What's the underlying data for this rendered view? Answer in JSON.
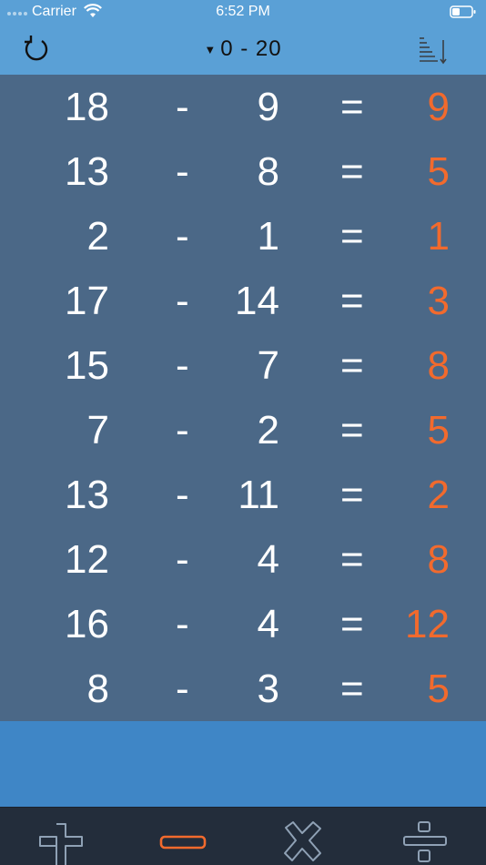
{
  "status": {
    "carrier": "Carrier",
    "time": "6:52 PM"
  },
  "nav": {
    "range_label": "0 - 20",
    "caret": "▼"
  },
  "colors": {
    "accent": "#f26a2d",
    "nav_bg": "#5aa0d6",
    "list_bg": "#4b6887",
    "band_bg": "#3f86c6",
    "tabbar_bg": "#232d3b"
  },
  "equations": [
    {
      "a": "18",
      "op": "-",
      "b": "9",
      "eq": "=",
      "result": "9"
    },
    {
      "a": "13",
      "op": "-",
      "b": "8",
      "eq": "=",
      "result": "5"
    },
    {
      "a": "2",
      "op": "-",
      "b": "1",
      "eq": "=",
      "result": "1"
    },
    {
      "a": "17",
      "op": "-",
      "b": "14",
      "eq": "=",
      "result": "3"
    },
    {
      "a": "15",
      "op": "-",
      "b": "7",
      "eq": "=",
      "result": "8"
    },
    {
      "a": "7",
      "op": "-",
      "b": "2",
      "eq": "=",
      "result": "5"
    },
    {
      "a": "13",
      "op": "-",
      "b": "11",
      "eq": "=",
      "result": "2"
    },
    {
      "a": "12",
      "op": "-",
      "b": "4",
      "eq": "=",
      "result": "8"
    },
    {
      "a": "16",
      "op": "-",
      "b": "4",
      "eq": "=",
      "result": "12"
    },
    {
      "a": "8",
      "op": "-",
      "b": "3",
      "eq": "=",
      "result": "5"
    }
  ],
  "tabs": [
    {
      "icon": "plus-icon",
      "selected": false
    },
    {
      "icon": "minus-icon",
      "selected": true
    },
    {
      "icon": "multiply-icon",
      "selected": false
    },
    {
      "icon": "divide-icon",
      "selected": false
    }
  ]
}
